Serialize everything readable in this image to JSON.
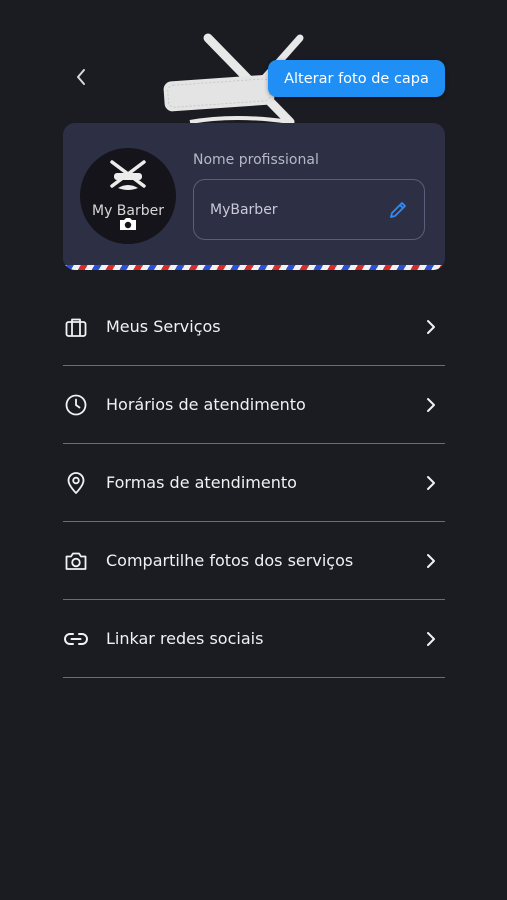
{
  "header": {
    "back_icon": "chevron-left-icon",
    "cover_button_label": "Alterar foto de capa"
  },
  "colors": {
    "background": "#1b1c22",
    "accent": "#1f8ff5",
    "card": "#2d2f45",
    "stripe_red": "#d62b2b",
    "stripe_blue": "#2b4fd6"
  },
  "profile": {
    "avatar_text": "My Barber",
    "avatar_camera_icon": "camera-icon",
    "name_label": "Nome profissional",
    "name_value": "MyBarber",
    "edit_icon": "pencil-icon"
  },
  "menu": {
    "items": [
      {
        "label": "Meus Serviços",
        "icon": "briefcase-icon"
      },
      {
        "label": "Horários de atendimento",
        "icon": "clock-icon"
      },
      {
        "label": "Formas de atendimento",
        "icon": "location-pin-icon"
      },
      {
        "label": "Compartilhe fotos dos serviços",
        "icon": "camera-icon"
      },
      {
        "label": "Linkar redes sociais",
        "icon": "link-icon"
      }
    ]
  }
}
